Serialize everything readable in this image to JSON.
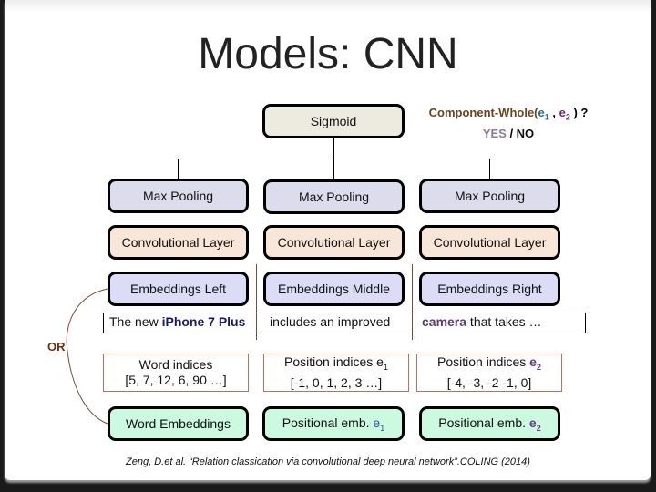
{
  "slide": {
    "title": "Models: CNN",
    "output": {
      "sigmoid_label": "Sigmoid",
      "question_prefix": "Component-Whole(",
      "question_e1": "e",
      "question_e1_sub": "1",
      "question_sep": " , ",
      "question_e2": "e",
      "question_e2_sub": "2",
      "question_suffix": " ) ?",
      "answer_yes": "YES",
      "answer_sep": " / ",
      "answer_no": "NO"
    },
    "columns": [
      {
        "pool": "Max Pooling",
        "conv": "Convolutional Layer",
        "emb": "Embeddings Left"
      },
      {
        "pool": "Max Pooling",
        "conv": "Convolutional Layer",
        "emb": "Embeddings Middle"
      },
      {
        "pool": "Max Pooling",
        "conv": "Convolutional Layer",
        "emb": "Embeddings Right"
      }
    ],
    "sentence": {
      "left_plain": "The new ",
      "left_bold": "iPhone 7 Plus",
      "middle": "includes an improved",
      "right_bold": "camera",
      "right_plain": " that takes …"
    },
    "or_label": "OR",
    "indices": [
      {
        "line1": "Word indices",
        "line2": "[5, 7, 12, 6, 90 …]"
      },
      {
        "line1": "Position indices e",
        "sub": "1",
        "line2": "[-1, 0, 1, 2, 3 …]"
      },
      {
        "line1": "Position indices ",
        "entity": "e",
        "sub": "2",
        "line2": "[-4, -3, -2 -1, 0]"
      }
    ],
    "embeddings": [
      {
        "label": "Word Embeddings"
      },
      {
        "label": "Positional emb. ",
        "entity": "e",
        "sub": "1"
      },
      {
        "label": "Positional emb. ",
        "entity": "e",
        "sub": "2"
      }
    ],
    "citation": "Zeng, D.et al. “Relation classication via convolutional deep neural network”.COLING (2014)"
  }
}
